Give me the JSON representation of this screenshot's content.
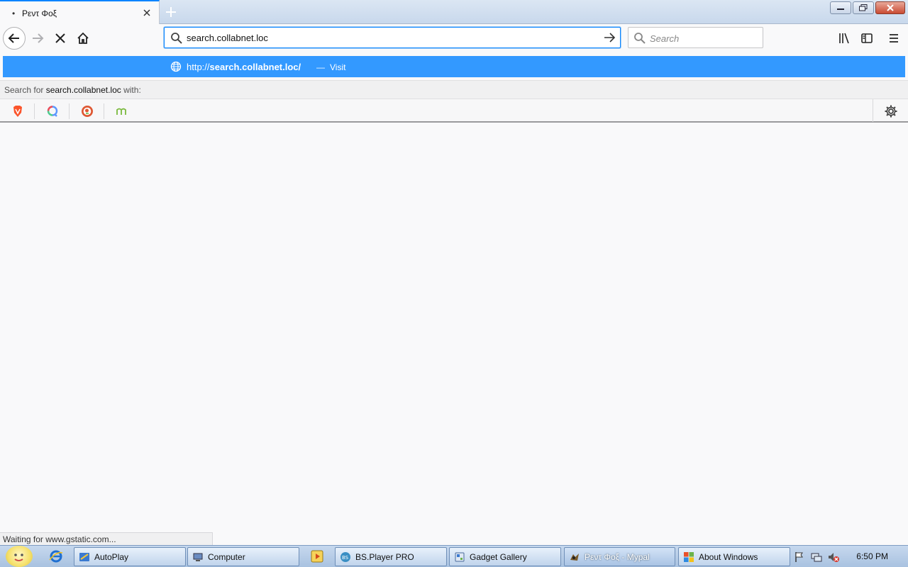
{
  "browser": {
    "tab": {
      "title": "Ρεντ Φοξ",
      "bullet": "•"
    },
    "window_buttons": [
      "minimize",
      "restore",
      "close"
    ]
  },
  "navbar": {
    "url_value": "search.collabnet.loc",
    "search_placeholder": "Search"
  },
  "suggestion": {
    "url_prefix": "http://",
    "url_host": "search.collabnet.loc/",
    "separator": "—",
    "action": "Visit"
  },
  "oneoff": {
    "prefix": "Search for ",
    "term": "search.collabnet.loc",
    "suffix": " with:",
    "engines": [
      {
        "name": "Brave",
        "icon": "brave-icon",
        "color": "#fb542b"
      },
      {
        "name": "Qwant",
        "icon": "qwant-icon",
        "color": "#5c97ff"
      },
      {
        "name": "DuckDuckGo",
        "icon": "duckduckgo-icon",
        "color": "#de5833"
      },
      {
        "name": "Mojeek",
        "icon": "mojeek-icon",
        "color": "#7ab93d"
      }
    ]
  },
  "status": {
    "text": "Waiting for www.gstatic.com..."
  },
  "taskbar": {
    "items": [
      {
        "label": "AutoPlay",
        "icon": "autoplay-icon"
      },
      {
        "label": "Computer",
        "icon": "computer-icon"
      },
      {
        "label": "BS.Player PRO",
        "icon": "bsplayer-icon"
      },
      {
        "label": "Gadget Gallery",
        "icon": "gadget-gallery-icon"
      },
      {
        "label": "Ρεντ Φοξ - Mypal",
        "icon": "mypal-icon"
      },
      {
        "label": "About Windows",
        "icon": "windows-icon"
      }
    ],
    "clock": "6:50 PM"
  },
  "colors": {
    "accent": "#0a84ff",
    "suggestion_bg": "#3399ff",
    "taskbar_bg": "#b8cde8"
  }
}
